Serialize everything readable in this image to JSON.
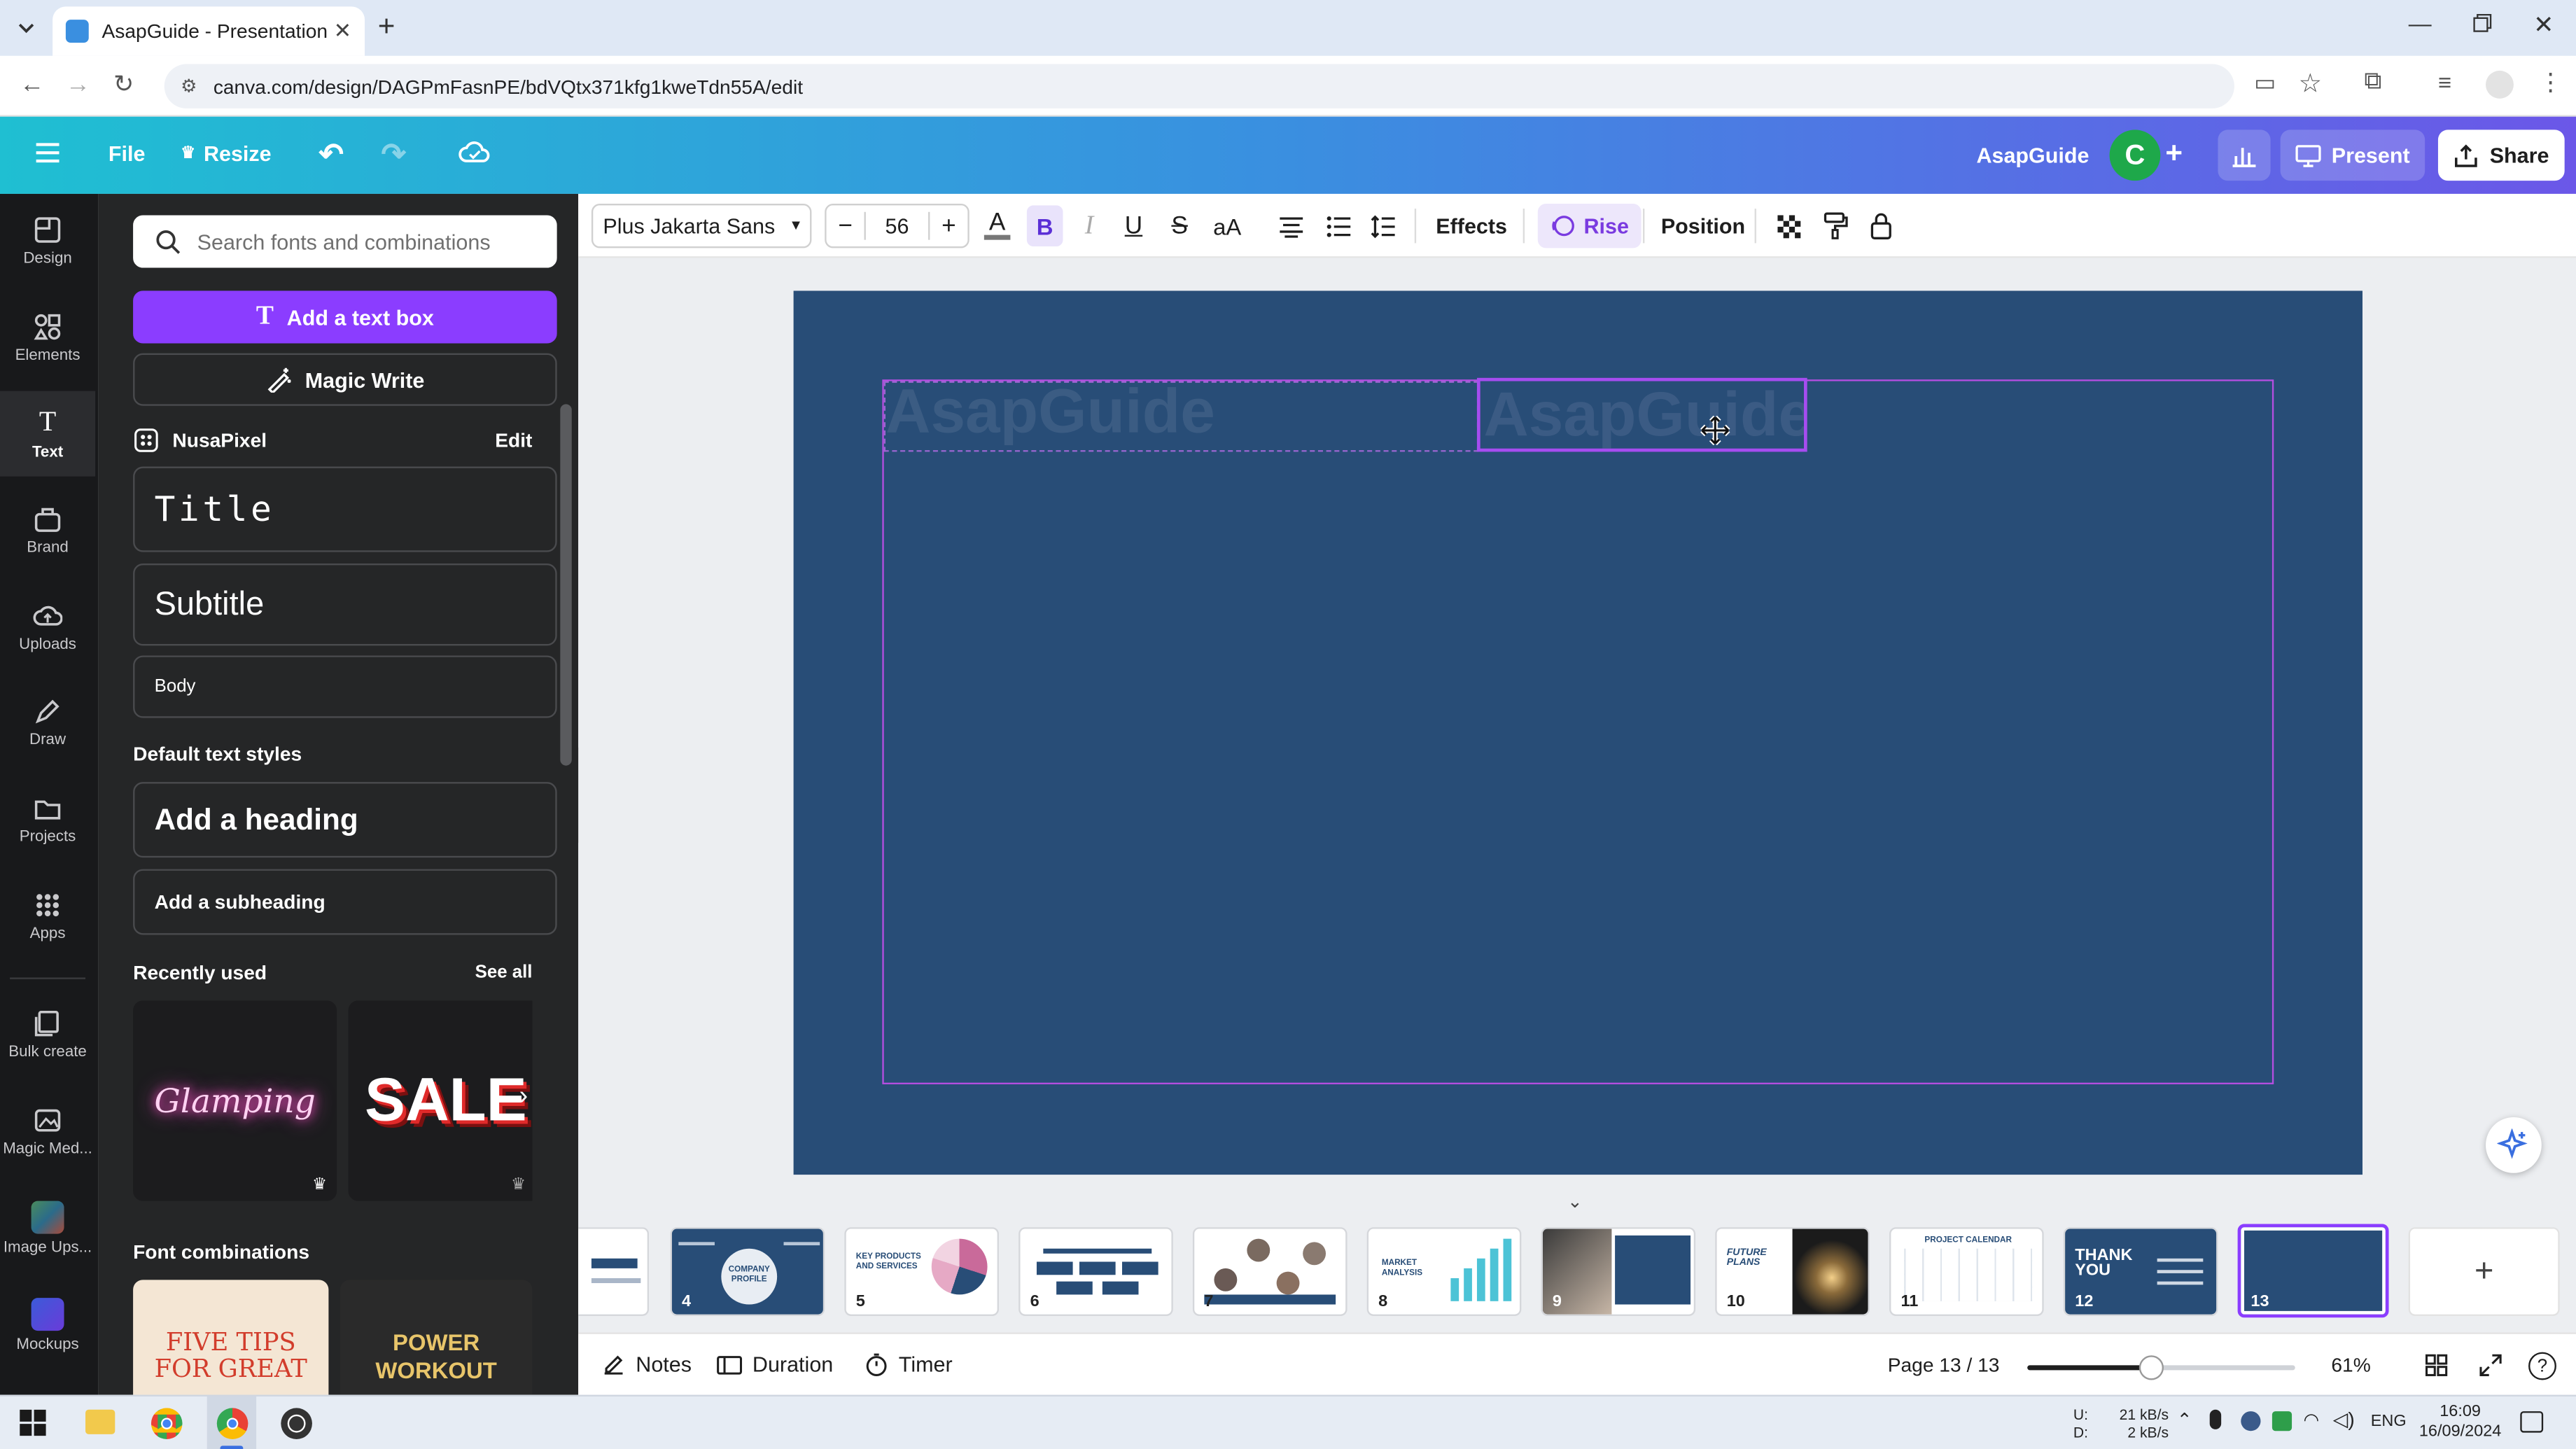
{
  "browser": {
    "tab_title": "AsapGuide - Presentation",
    "url": "canva.com/design/DAGPmFasnPE/bdVQtx371kfg1kweTdn55A/edit"
  },
  "header": {
    "file": "File",
    "resize": "Resize",
    "brand_name": "AsapGuide",
    "avatar_letter": "C",
    "present": "Present",
    "share": "Share"
  },
  "rail": [
    {
      "label": "Design",
      "icon": "design-icon"
    },
    {
      "label": "Elements",
      "icon": "elements-icon"
    },
    {
      "label": "Text",
      "icon": "text-icon"
    },
    {
      "label": "Brand",
      "icon": "brand-icon"
    },
    {
      "label": "Uploads",
      "icon": "uploads-icon"
    },
    {
      "label": "Draw",
      "icon": "draw-icon"
    },
    {
      "label": "Projects",
      "icon": "projects-icon"
    },
    {
      "label": "Apps",
      "icon": "apps-icon"
    },
    {
      "label": "Bulk create",
      "icon": "bulk-create-icon"
    },
    {
      "label": "Magic Med...",
      "icon": "magic-media-icon"
    },
    {
      "label": "Image Ups...",
      "icon": "image-upscaler-icon"
    },
    {
      "label": "Mockups",
      "icon": "mockups-icon"
    }
  ],
  "panel": {
    "search_placeholder": "Search fonts and combinations",
    "add_text_box": "Add a text box",
    "magic_write": "Magic Write",
    "brand_kit_name": "NusaPixel",
    "edit": "Edit",
    "styles": {
      "title": "Title",
      "subtitle": "Subtitle",
      "body": "Body"
    },
    "default_styles_heading": "Default text styles",
    "add_heading": "Add a heading",
    "add_subheading": "Add a subheading",
    "recently_used": "Recently used",
    "see_all": "See all",
    "recent_samples": [
      "Glamping",
      "SALE"
    ],
    "font_combinations": "Font combinations",
    "combo_samples": [
      "FIVE TIPS FOR GREAT",
      "POWER WORKOUT"
    ]
  },
  "toolbar": {
    "font": "Plus Jakarta Sans",
    "font_size": "56",
    "effects": "Effects",
    "animation": "Rise",
    "position": "Position"
  },
  "slide": {
    "text_left": "AsapGuide",
    "text_right": "AsapGuide",
    "background": "#284d77"
  },
  "filmstrip": {
    "pages": [
      "4",
      "5",
      "6",
      "7",
      "8",
      "9",
      "10",
      "11",
      "12",
      "13"
    ],
    "captions": {
      "4": "COMPANY PROFILE",
      "5": "KEY PRODUCTS AND SERVICES",
      "8": "MARKET ANALYSIS",
      "10": "FUTURE PLANS",
      "11": "PROJECT CALENDAR",
      "12": "THANK YOU"
    },
    "active_page": "13"
  },
  "footer": {
    "notes": "Notes",
    "duration": "Duration",
    "timer": "Timer",
    "page_indicator": "Page 13 / 13",
    "zoom": "61%"
  },
  "taskbar": {
    "net_up_label": "U:",
    "net_down_label": "D:",
    "net_up": "21 kB/s",
    "net_down": "2 kB/s",
    "language": "ENG",
    "time": "16:09",
    "date": "16/09/2024"
  },
  "colors": {
    "accent_purple": "#8b3dff",
    "slide_bg": "#284d77",
    "selection": "#a64df0"
  }
}
